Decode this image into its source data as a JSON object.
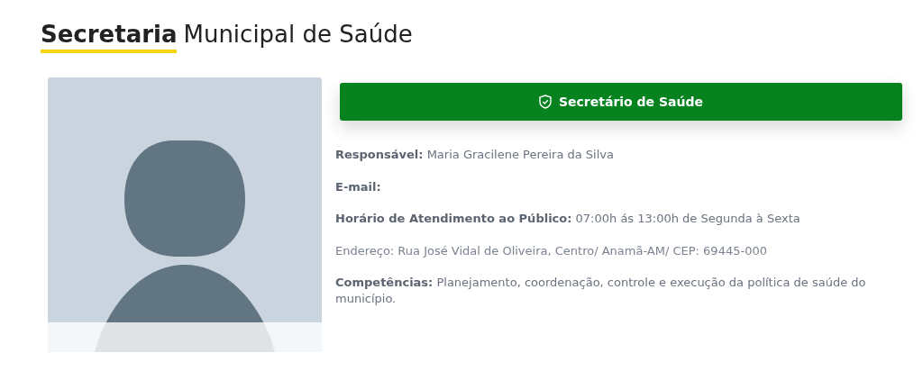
{
  "heading": {
    "highlight": "Secretaria",
    "rest": "Municipal de Saúde"
  },
  "role_button": {
    "label": "Secretário de Saúde"
  },
  "details": [
    {
      "kind": "labeled",
      "label": "Responsável:",
      "value": "Maria Gracilene Pereira da Silva"
    },
    {
      "kind": "labeled",
      "label": "E-mail:"
    },
    {
      "kind": "labeled",
      "label": "Horário de Atendimento ao Público:",
      "value": "07:00h ás 13:00h de Segunda à Sexta"
    },
    {
      "kind": "plain",
      "value": "Endereço: Rua José Vidal de Oliveira, Centro/ Anamã-AM/ CEP: 69445-000"
    },
    {
      "kind": "labeled",
      "label": "Competências:",
      "value": "Planejamento, coordenação, controle e execução da política de saúde do município."
    }
  ]
}
